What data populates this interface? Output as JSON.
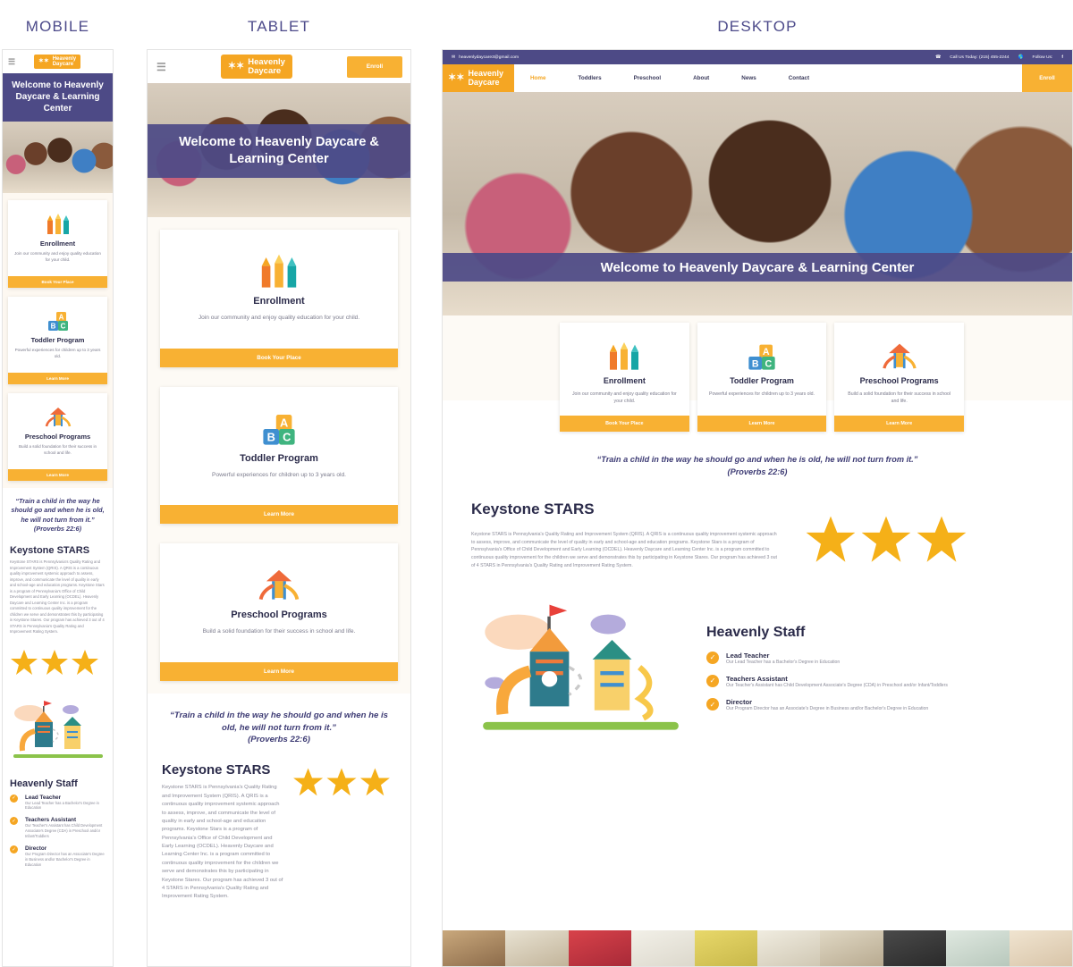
{
  "columns": [
    {
      "label": "MOBILE"
    },
    {
      "label": "TABLET"
    },
    {
      "label": "DESKTOP"
    }
  ],
  "brand": {
    "name_line1": "Heavenly",
    "name_line2": "Daycare",
    "logo_icon": "stars-icon",
    "accent_orange": "#f5a623",
    "accent_purple": "#4d4a86",
    "star_gold": "#f5b018"
  },
  "topbar": {
    "email_icon": "envelope-icon",
    "email": "heavenlydaycare3@gmail.com",
    "phone_icon": "phone-icon",
    "phone": "Call Us Today: (215) 455-2244",
    "follow_icon": "globe-icon",
    "follow_label": "Follow Us:",
    "facebook_icon": "facebook-icon"
  },
  "nav": {
    "hamburger_icon": "hamburger-icon",
    "items": [
      {
        "label": "Home",
        "active": true
      },
      {
        "label": "Toddlers",
        "active": false
      },
      {
        "label": "Preschool",
        "active": false
      },
      {
        "label": "About",
        "active": false
      },
      {
        "label": "News",
        "active": false
      },
      {
        "label": "Contact",
        "active": false
      }
    ],
    "enroll_label": "Enroll"
  },
  "hero": {
    "headline": "Welcome to Heavenly Daycare & Learning Center",
    "photo_alt": "children-coloring-photo"
  },
  "cards": [
    {
      "icon": "crayons-icon",
      "title": "Enrollment",
      "text": "Join our community and enjoy quality education for your child.",
      "cta": "Book Your Place"
    },
    {
      "icon": "abc-blocks-icon",
      "title": "Toddler Program",
      "text": "Powerful experiences for children up to 3 years old.",
      "cta": "Learn More"
    },
    {
      "icon": "playground-slide-icon",
      "title": "Preschool Programs",
      "text": "Build a solid foundation for their success in school and life.",
      "cta": "Learn More"
    }
  ],
  "quote": {
    "line1": "“Train a child in the way he should go and when he is old, he will not turn from it.”",
    "line2": "(Proverbs 22:6)"
  },
  "keystone": {
    "title": "Keystone STARS",
    "body": "Keystone STARS is Pennsylvania's Quality Rating and Improvement System (QRIS). A QRIS is a continuous quality improvement systemic approach to assess, improve, and communicate the level of quality in early and school-age and education programs. Keystone Stars is a program of Pennsylvania's Office of Child Development and Early Learning (OCDEL). Heavenly Daycare and Learning Center Inc. is a program committed to continuous quality improvement for the children we serve and demonstrates this by participating in Keystone Stares. Our program has achieved 3 out of 4 STARS in Pennsylvania's Quality Rating and Improvement Rating System.",
    "stars_count": 3,
    "stars_icon": "star-icon"
  },
  "staff": {
    "illustration": "playground-illustration",
    "title": "Heavenly Staff",
    "check_icon": "check-circle-icon",
    "members": [
      {
        "name": "Lead Teacher",
        "desc": "Our Lead Teacher has a Bachelor's Degree in Education"
      },
      {
        "name": "Teachers Assistant",
        "desc": "Our Teacher's Assistant has Child Development Associate's Degree (CDA) in Preschool and/or Infant/Toddlers"
      },
      {
        "name": "Director",
        "desc": "Our Program Director has an Associate's Degree in Business and/or Bachelor's Degree in Education"
      }
    ]
  },
  "gallery": {
    "alt": "classroom-photo-strip"
  }
}
